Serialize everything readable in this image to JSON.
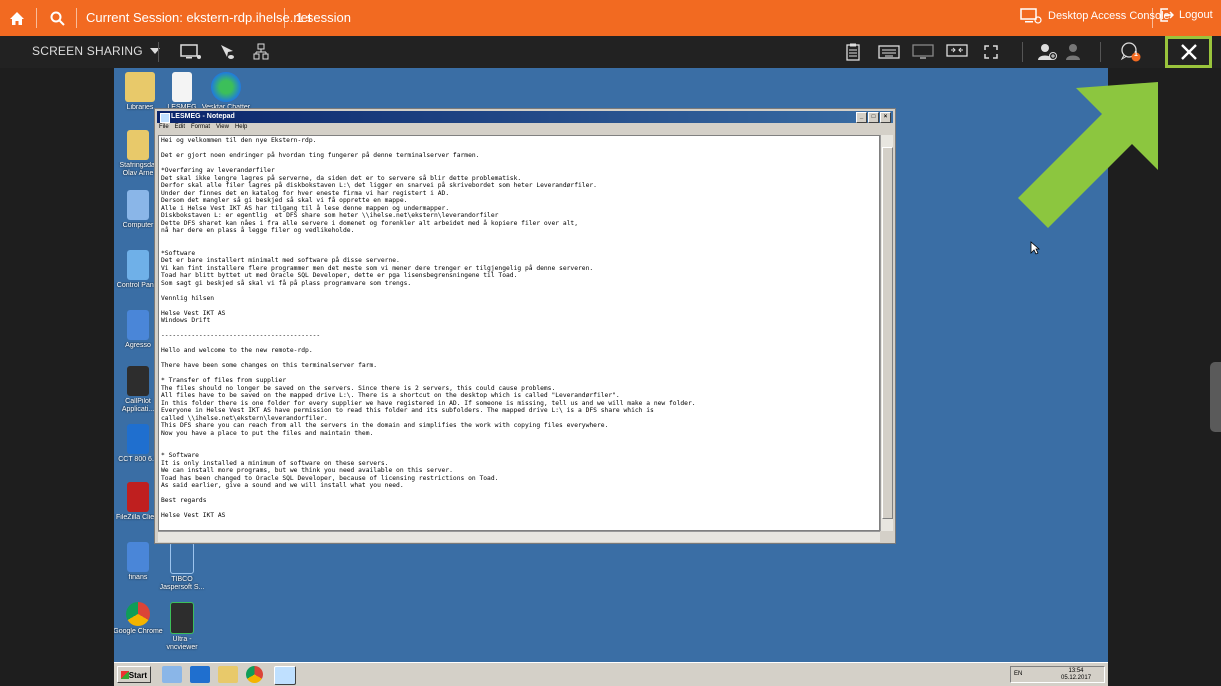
{
  "topbar": {
    "session_label": "Current Session: ekstern-rdp.ihelse.net",
    "session_count": "1 session",
    "desktop_access_console": "Desktop Access Console",
    "logout": "Logout"
  },
  "toolbar": {
    "screen_sharing": "SCREEN SHARING",
    "notification_count": "1"
  },
  "colors": {
    "accent": "#f26a21",
    "toolbar_bg": "#222222",
    "desktop_bg": "#3a6ea5",
    "highlight": "#9ac43c",
    "arrow": "#8cc63f"
  },
  "desktop_icons": [
    {
      "label": "Libraries"
    },
    {
      "label": "LESMEG"
    },
    {
      "label": "Vesktar Chatter"
    },
    {
      "label": "Stafringsdal Olav Arne"
    },
    {
      "label": "Computer"
    },
    {
      "label": "Control Panel"
    },
    {
      "label": "Agresso"
    },
    {
      "label": "CallPilot Applicati..."
    },
    {
      "label": "CCT 800 6.1"
    },
    {
      "label": "FileZilla Client"
    },
    {
      "label": "finans"
    },
    {
      "label": "TIBCO Jaspersoft S..."
    },
    {
      "label": "Google Chrome"
    },
    {
      "label": "Ultra - vncviewer"
    }
  ],
  "notepad": {
    "title": "LESMEG - Notepad",
    "menu": [
      "File",
      "Edit",
      "Format",
      "View",
      "Help"
    ],
    "content": "Hei og velkommen til den nye Ekstern-rdp.\n\nDet er gjort noen endringer på hvordan ting fungerer på denne terminalserver farmen.\n\n*Overføring av leverandørfiler\nDet skal ikke lengre lagres på serverne, da siden det er to servere så blir dette problematisk.\nDerfor skal alle filer lagres på diskbokstaven L:\\ det ligger en snarvei på skrivebordet som heter Leverandørfiler.\nUnder der finnes det en katalog for hver eneste firma vi har registert i AD.\nDersom det mangler så gi beskjed så skal vi få opprette en mappe.\nAlle i Helse Vest IKT AS har tilgang til å lese denne mappen og undermapper.\nDiskbokstaven L: er egentlig  et DFS share som heter \\\\ihelse.net\\ekstern\\leverandorfiler\nDette DFS sharet kan nåes i fra alle servere i domenet og forenkler alt arbeidet med å kopiere filer over alt,\nnå har dere en plass å legge filer og vedlikeholde.\n\n\n*Software\nDet er bare installert minimalt med software på disse serverne.\nVi kan fint installere flere programmer men det meste som vi mener dere trenger er tilgjengelig på denne serveren.\nToad har blitt byttet ut med Oracle SQL Developer, dette er pga lisensbegrensningene til Toad.\nSom sagt gi beskjed så skal vi få på plass programvare som trengs.\n\nVennlig hilsen\n\nHelse Vest IKT AS\nWindows Drift\n\n------------------------------------------\n\nHello and welcome to the new remote-rdp.\n\nThere have been some changes on this terminalserver farm.\n\n* Transfer of files from supplier\nThe files should no longer be saved on the servers. Since there is 2 servers, this could cause problems.\nAll files have to be saved on the mapped drive L:\\. There is a shortcut on the desktop which is called \"Leverandørfiler\".\nIn this folder there is one folder for every supplier we have registered in AD. If someone is missing, tell us and we will make a new folder.\nEveryone in Helse Vest IKT AS have permission to read this folder and its subfolders. The mapped drive L:\\ is a DFS share which is\ncalled \\\\ihelse.net\\ekstern\\leverandorfiler.\nThis DFS share you can reach from all the servers in the domain and simplifies the work with copying files everywhere.\nNow you have a place to put the files and maintain them.\n\n\n* Software\nIt is only installed a minimum of software on these servers.\nWe can install more programs, but we think you need available on this server.\nToad has been changed to Oracle SQL Developer, because of licensing restrictions on Toad.\nAs said earlier, give a sound and we will install what you need.\n\nBest regards\n\nHelse Vest IKT AS"
  },
  "taskbar": {
    "start": "Start",
    "lang": "EN",
    "time": "13:54",
    "date": "05.12.2017"
  }
}
